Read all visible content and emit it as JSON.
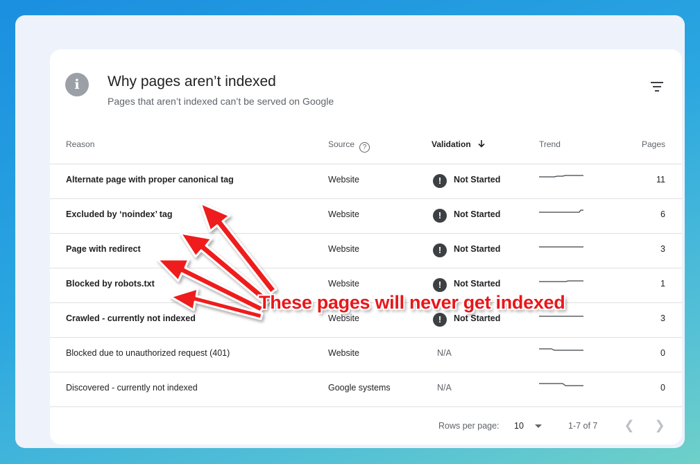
{
  "header": {
    "title": "Why pages aren’t indexed",
    "subtitle": "Pages that aren’t indexed can’t be served on Google"
  },
  "columns": {
    "reason": "Reason",
    "source": "Source",
    "validation": "Validation",
    "trend": "Trend",
    "pages": "Pages"
  },
  "rows": [
    {
      "reason": "Alternate page with proper canonical tag",
      "source": "Website",
      "validation": "Not Started",
      "pages": "11",
      "bold": true,
      "status": "not-started"
    },
    {
      "reason": "Excluded by ‘noindex’ tag",
      "source": "Website",
      "validation": "Not Started",
      "pages": "6",
      "bold": true,
      "status": "not-started"
    },
    {
      "reason": "Page with redirect",
      "source": "Website",
      "validation": "Not Started",
      "pages": "3",
      "bold": true,
      "status": "not-started"
    },
    {
      "reason": "Blocked by robots.txt",
      "source": "Website",
      "validation": "Not Started",
      "pages": "1",
      "bold": true,
      "status": "not-started"
    },
    {
      "reason": "Crawled - currently not indexed",
      "source": "Website",
      "validation": "Not Started",
      "pages": "3",
      "bold": true,
      "status": "not-started"
    },
    {
      "reason": "Blocked due to unauthorized request (401)",
      "source": "Website",
      "validation": "N/A",
      "pages": "0",
      "bold": false,
      "status": "na"
    },
    {
      "reason": "Discovered - currently not indexed",
      "source": "Google systems",
      "validation": "N/A",
      "pages": "0",
      "bold": false,
      "status": "na"
    }
  ],
  "footer": {
    "rows_per_page_label": "Rows per page:",
    "rows_per_page_value": "10",
    "range": "1-7 of 7"
  },
  "annotation": {
    "callout": "These pages will never get indexed"
  },
  "icons": {
    "header": "info-icon",
    "filter": "filter-icon",
    "source_help": "help-icon",
    "sort": "arrow-down-icon",
    "status": "exclamation-icon",
    "prev": "chevron-left-icon",
    "next": "chevron-right-icon"
  },
  "colors": {
    "status_icon": "#3c4043",
    "annotation": "#e8171b"
  }
}
